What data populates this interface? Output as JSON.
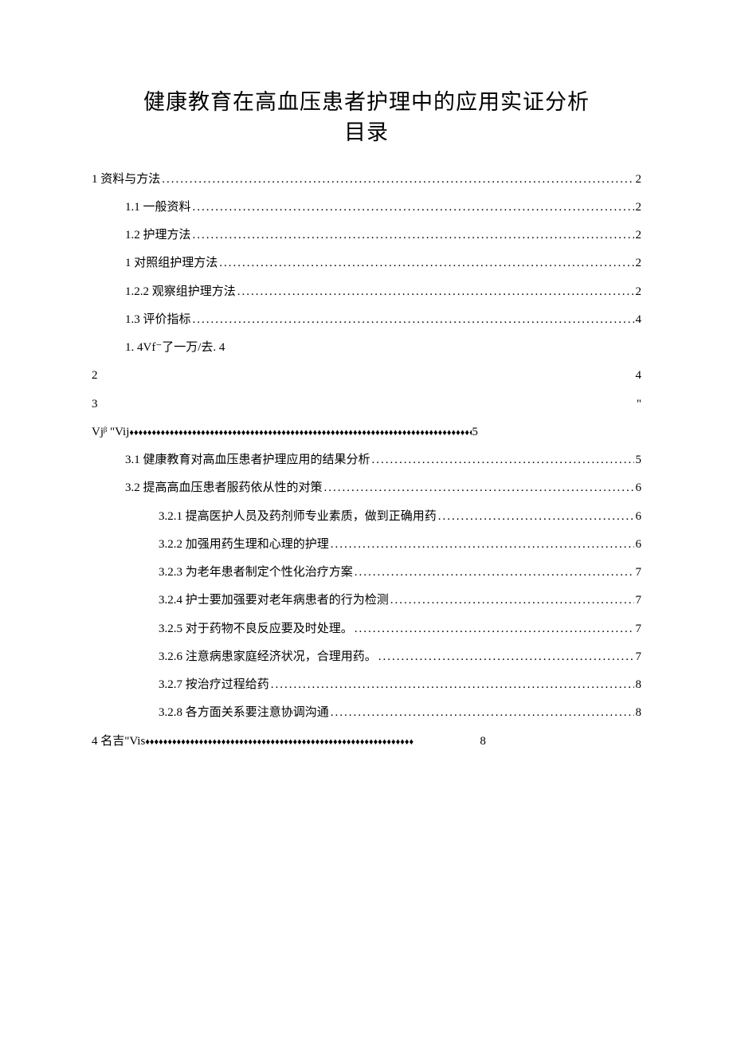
{
  "title_line1": "健康教育在高血压患者护理中的应用实证分析",
  "title_line2": "目录",
  "toc": [
    {
      "indent": 0,
      "label": "1 资料与方法",
      "page": "2",
      "leader": "dot"
    },
    {
      "indent": 1,
      "label": "1.1 一般资料",
      "page": "2",
      "leader": "dot"
    },
    {
      "indent": 1,
      "label": "1.2 护理方法",
      "page": "2",
      "leader": "dot"
    },
    {
      "indent": 1,
      "label": "1 对照组护理方法",
      "page": "2",
      "leader": "dot"
    },
    {
      "indent": 1,
      "label": "1.2.2 观察组护理方法",
      "page": "2",
      "leader": "dot"
    },
    {
      "indent": 1,
      "label": "1.3 评价指标",
      "page": "4",
      "leader": "dot"
    },
    {
      "indent": 1,
      "label": "1. 4Vf⁻了一万/去. 4",
      "page": "",
      "leader": "none"
    },
    {
      "indent": 0,
      "label": "2",
      "page": "4",
      "leader": "none_wide"
    },
    {
      "indent": 0,
      "type": "split",
      "line1_left": "3",
      "line1_right": "\"",
      "line2_label": "Vjᵝ \"Vij",
      "line2_page": "5",
      "line2_leader": "diamond"
    },
    {
      "indent": 1,
      "label": "3.1 健康教育对高血压患者护理应用的结果分析",
      "page": "5",
      "leader": "dot"
    },
    {
      "indent": 1,
      "label": "3.2 提高高血压患者服药依从性的对策",
      "page": "6",
      "leader": "dot"
    },
    {
      "indent": 2,
      "label": "3.2.1 提高医护人员及药剂师专业素质，做到正确用药",
      "page": "6",
      "leader": "dot"
    },
    {
      "indent": 2,
      "label": "3.2.2 加强用药生理和心理的护理",
      "page": "6",
      "leader": "dot"
    },
    {
      "indent": 2,
      "label": "3.2.3 为老年患者制定个性化治疗方案",
      "page": "7",
      "leader": "dot"
    },
    {
      "indent": 2,
      "label": "3.2.4 护士要加强要对老年病患者的行为检测",
      "page": "7",
      "leader": "dot"
    },
    {
      "indent": 2,
      "label": "3.2.5 对于药物不良反应要及时处理。",
      "page": "7",
      "leader": "dot"
    },
    {
      "indent": 2,
      "label": "3.2.6 注意病患家庭经济状况，合理用药。",
      "page": "7",
      "leader": "dot"
    },
    {
      "indent": 2,
      "label": "3.2.7 按治疗过程给药",
      "page": "8",
      "leader": "dot"
    },
    {
      "indent": 2,
      "label": "3.2.8 各方面关系要注意协调沟通",
      "page": "8",
      "leader": "dot"
    },
    {
      "indent": 0,
      "label": "4 名吉\"Vis",
      "page": "8",
      "leader": "diamond_short"
    }
  ],
  "leaders": {
    "dot": "............................................................................................................................................",
    "diamond": "♦♦♦♦♦♦♦♦♦♦♦♦♦♦♦♦♦♦♦♦♦♦♦♦♦♦♦♦♦♦♦♦♦♦♦♦♦♦♦♦♦♦♦♦♦♦♦♦♦♦♦♦♦♦♦♦♦♦♦♦♦♦♦♦♦♦♦♦♦♦♦♦♦♦♦♦♦♦♦♦♦♦♦♦♦♦♦♦♦♦♦♦♦♦♦♦♦♦♦♦♦♦♦♦♦♦♦♦♦♦♦♦♦♦♦♦♦♦♦♦",
    "diamond_short": "♦♦♦♦♦♦♦♦♦♦♦♦♦♦♦♦♦♦♦♦♦♦♦♦♦♦♦♦♦♦♦♦♦♦♦♦♦♦♦♦♦♦♦♦♦♦♦♦♦♦♦♦♦♦♦♦♦♦♦♦"
  }
}
